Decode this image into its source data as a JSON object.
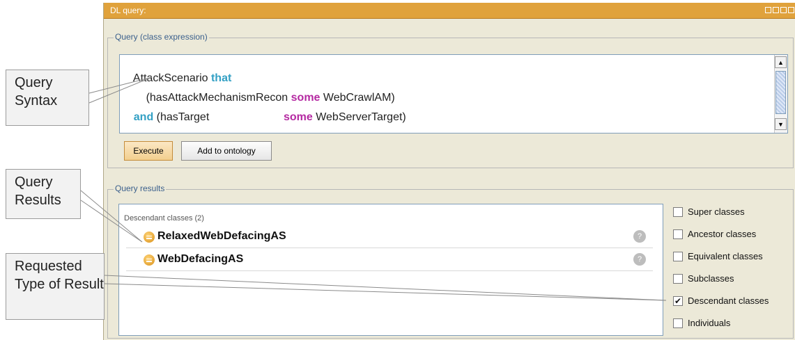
{
  "window": {
    "title": "DL query:"
  },
  "query_group": {
    "label": "Query (class expression)",
    "lines": [
      {
        "a": "AttackScenario ",
        "kw1": "that",
        "b": "",
        "kw2": "",
        "c": ""
      },
      {
        "a": "    (hasAttackMechanismRecon ",
        "kw1": "",
        "b": "",
        "kw2": "some",
        "c": " WebCrawlAM)"
      },
      {
        "a": "",
        "kw1": "and",
        "b": " (hasTarget                        ",
        "kw2": "some",
        "c": " WebServerTarget)"
      }
    ],
    "execute_label": "Execute",
    "add_label": "Add to ontology"
  },
  "results_group": {
    "label": "Query results",
    "header": "Descendant classes (2)",
    "items": [
      {
        "label": "RelaxedWebDefacingAS",
        "help": "?"
      },
      {
        "label": "WebDefacingAS",
        "help": "?"
      }
    ],
    "options": [
      {
        "label": "Super classes",
        "checked": false,
        "mark": ""
      },
      {
        "label": "Ancestor classes",
        "checked": false,
        "mark": ""
      },
      {
        "label": "Equivalent classes",
        "checked": false,
        "mark": ""
      },
      {
        "label": "Subclasses",
        "checked": false,
        "mark": ""
      },
      {
        "label": "Descendant classes",
        "checked": true,
        "mark": "✔"
      },
      {
        "label": "Individuals",
        "checked": false,
        "mark": ""
      }
    ]
  },
  "callouts": {
    "syntax": "Query Syntax",
    "results": "Query Results",
    "type": "Requested Type of Result"
  },
  "colors": {
    "titlebar": "#e0a23c",
    "keyword_teal": "#33a0c4",
    "keyword_magenta": "#b52aa2"
  }
}
